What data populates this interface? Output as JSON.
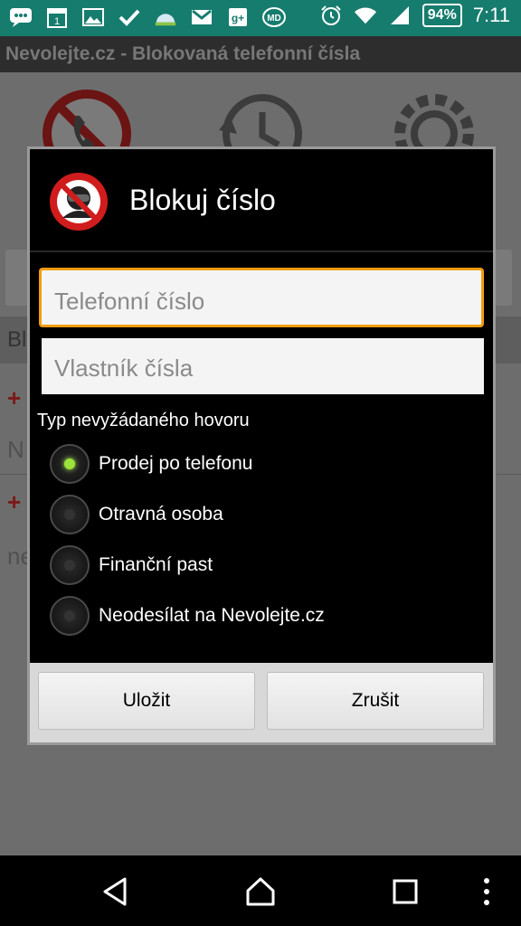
{
  "status_bar": {
    "icons": [
      "chat-icon",
      "calendar-icon",
      "image-icon",
      "check-icon",
      "weather-icon",
      "gmail-icon",
      "google-plus-icon",
      "mydroid-icon",
      "alarm-icon",
      "wifi-icon",
      "signal-icon"
    ],
    "battery": "94%",
    "time": "7:11"
  },
  "app_bar": {
    "title": "Nevolejte.cz - Blokovaná telefonní čísla"
  },
  "dialog": {
    "title": "Blokuj číslo",
    "phone_placeholder": "Telefonní číslo",
    "owner_placeholder": "Vlastník čísla",
    "type_label": "Typ nevyžádaného hovoru",
    "options": [
      {
        "label": "Prodej po telefonu",
        "checked": true
      },
      {
        "label": "Otravná osoba",
        "checked": false
      },
      {
        "label": "Finanční past",
        "checked": false
      },
      {
        "label": "Neodesílat na Nevolejte.cz",
        "checked": false
      }
    ],
    "save_label": "Uložit",
    "cancel_label": "Zrušit"
  },
  "colors": {
    "status_bar": "#167c6e",
    "focus_accent": "#f39c12",
    "radio_checked": "#9be23a"
  }
}
